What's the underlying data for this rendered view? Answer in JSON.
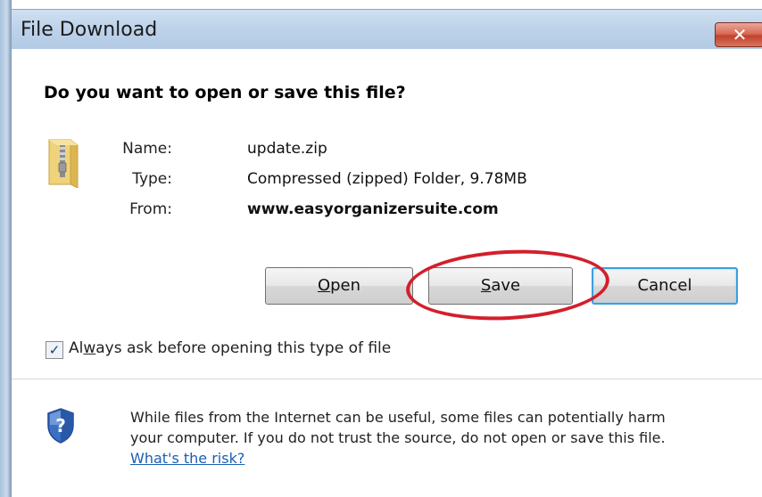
{
  "window": {
    "title": "File Download",
    "close_glyph": "✕"
  },
  "dialog": {
    "question": "Do you want to open or save this file?",
    "file": {
      "icon": "zip-folder-icon",
      "name_label": "Name:",
      "name_value": "update.zip",
      "type_label": "Type:",
      "type_value": "Compressed (zipped) Folder, 9.78MB",
      "from_label": "From:",
      "from_value": "www.easyorganizersuite.com"
    },
    "buttons": {
      "open": {
        "pre": "",
        "accel": "O",
        "post": "pen"
      },
      "save": {
        "pre": "",
        "accel": "S",
        "post": "ave"
      },
      "cancel": "Cancel"
    },
    "annotation": {
      "color": "#d31f2b",
      "target": "save-button"
    },
    "always_ask": {
      "checked": true,
      "pre": "Al",
      "accel": "w",
      "post": "ays ask before opening this type of file"
    }
  },
  "footer": {
    "icon": "shield-icon",
    "warning_line1": "While files from the Internet can be useful, some files can potentially harm",
    "warning_line2": "your computer. If you do not trust the source, do not open or save this file.",
    "risk_link": "What's the risk?"
  },
  "colors": {
    "titlebar": "#bed3ea",
    "close_button": "#c0432c",
    "default_button_border": "#3c9fe0",
    "link": "#1a5fb4"
  }
}
